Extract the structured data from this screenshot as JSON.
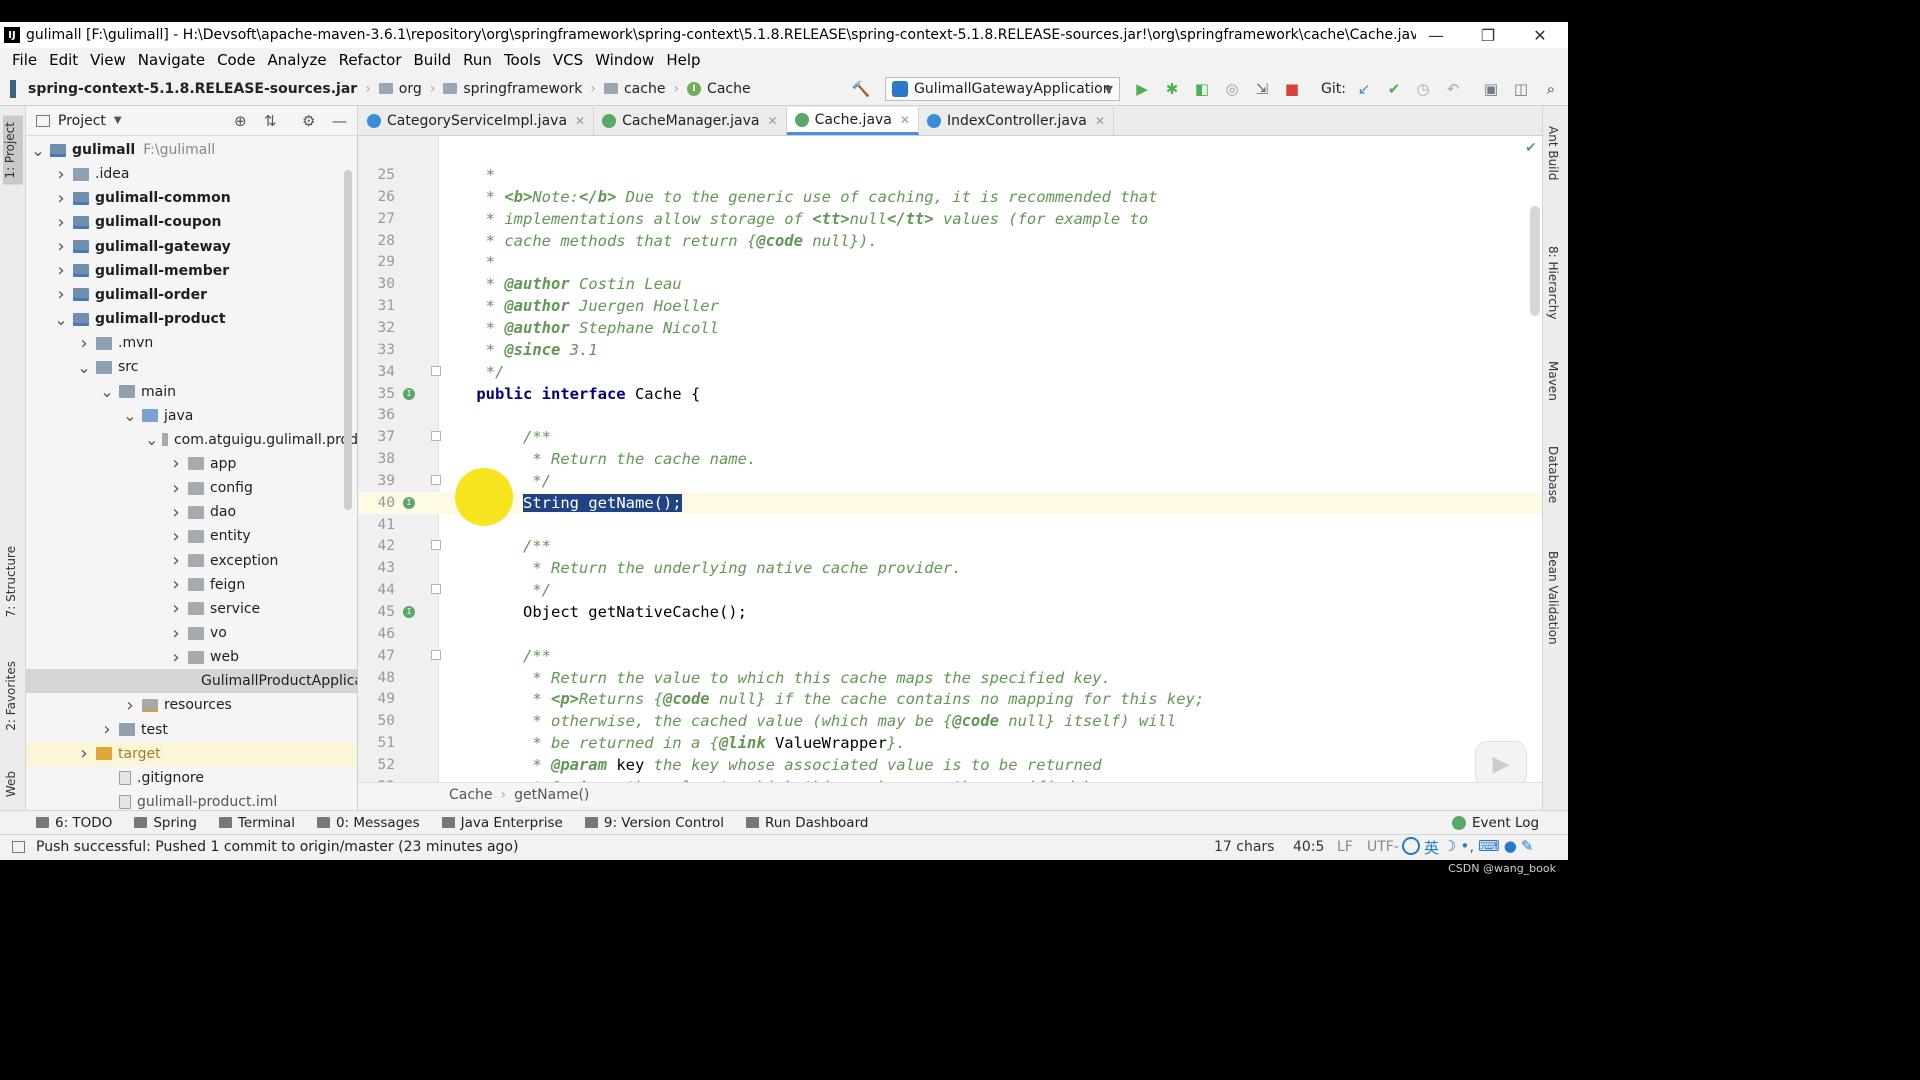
{
  "window": {
    "title": "gulimall [F:\\gulimall] - H:\\Devsoft\\apache-maven-3.6.1\\repository\\org\\springframework\\spring-context\\5.1.8.RELEASE\\spring-context-5.1.8.RELEASE-sources.jar!\\org\\springframework\\cache\\Cache.java [Ma...",
    "controls": {
      "minimize": "—",
      "restore": "❐",
      "close": "✕"
    }
  },
  "menu": [
    "File",
    "Edit",
    "View",
    "Navigate",
    "Code",
    "Analyze",
    "Refactor",
    "Build",
    "Run",
    "Tools",
    "VCS",
    "Window",
    "Help"
  ],
  "breadcrumb": [
    "spring-context-5.1.8.RELEASE-sources.jar",
    "org",
    "springframework",
    "cache",
    "Cache"
  ],
  "toolbar": {
    "run_config": "GulimallGatewayApplication",
    "git_label": "Git:"
  },
  "left_tool_tabs": {
    "project": "1: Project",
    "structure": "7: Structure",
    "favorites": "2: Favorites",
    "web": "Web"
  },
  "project_panel": {
    "title": "Project",
    "tree": [
      {
        "label": "gulimall",
        "hint": "F:\\gulimall",
        "depth": 0,
        "arrow": "down",
        "icon": "module",
        "bold": true
      },
      {
        "label": ".idea",
        "depth": 1,
        "arrow": "right",
        "icon": "folder"
      },
      {
        "label": "gulimall-common",
        "depth": 1,
        "arrow": "right",
        "icon": "module",
        "bold": true
      },
      {
        "label": "gulimall-coupon",
        "depth": 1,
        "arrow": "right",
        "icon": "module",
        "bold": true
      },
      {
        "label": "gulimall-gateway",
        "depth": 1,
        "arrow": "right",
        "icon": "module",
        "bold": true
      },
      {
        "label": "gulimall-member",
        "depth": 1,
        "arrow": "right",
        "icon": "module",
        "bold": true
      },
      {
        "label": "gulimall-order",
        "depth": 1,
        "arrow": "right",
        "icon": "module",
        "bold": true
      },
      {
        "label": "gulimall-product",
        "depth": 1,
        "arrow": "down",
        "icon": "module",
        "bold": true
      },
      {
        "label": ".mvn",
        "depth": 2,
        "arrow": "right",
        "icon": "folder"
      },
      {
        "label": "src",
        "depth": 2,
        "arrow": "down",
        "icon": "folder"
      },
      {
        "label": "main",
        "depth": 3,
        "arrow": "down",
        "icon": "folder"
      },
      {
        "label": "java",
        "depth": 4,
        "arrow": "down",
        "icon": "src"
      },
      {
        "label": "com.atguigu.gulimall.prod",
        "depth": 5,
        "arrow": "down",
        "icon": "pkg"
      },
      {
        "label": "app",
        "depth": 6,
        "arrow": "right",
        "icon": "pkg"
      },
      {
        "label": "config",
        "depth": 6,
        "arrow": "right",
        "icon": "pkg"
      },
      {
        "label": "dao",
        "depth": 6,
        "arrow": "right",
        "icon": "pkg"
      },
      {
        "label": "entity",
        "depth": 6,
        "arrow": "right",
        "icon": "pkg"
      },
      {
        "label": "exception",
        "depth": 6,
        "arrow": "right",
        "icon": "pkg"
      },
      {
        "label": "feign",
        "depth": 6,
        "arrow": "right",
        "icon": "pkg"
      },
      {
        "label": "service",
        "depth": 6,
        "arrow": "right",
        "icon": "pkg"
      },
      {
        "label": "vo",
        "depth": 6,
        "arrow": "right",
        "icon": "pkg"
      },
      {
        "label": "web",
        "depth": 6,
        "arrow": "right",
        "icon": "pkg"
      },
      {
        "label": "GulimallProductApplica",
        "depth": 7,
        "arrow": "none",
        "icon": "class",
        "selected": true
      },
      {
        "label": "resources",
        "depth": 4,
        "arrow": "right",
        "icon": "res"
      },
      {
        "label": "test",
        "depth": 3,
        "arrow": "right",
        "icon": "folder"
      },
      {
        "label": "target",
        "depth": 2,
        "arrow": "right",
        "icon": "target",
        "highlight": true
      },
      {
        "label": ".gitignore",
        "depth": 3,
        "arrow": "none",
        "icon": "file"
      },
      {
        "label": "gulimall-product.iml",
        "depth": 3,
        "arrow": "none",
        "icon": "file"
      }
    ]
  },
  "tabs": [
    {
      "label": "CategoryServiceImpl.java",
      "icon_color": "#3c8bd9",
      "active": false
    },
    {
      "label": "CacheManager.java",
      "icon_color": "#59a869",
      "active": false
    },
    {
      "label": "Cache.java",
      "icon_color": "#59a869",
      "active": true
    },
    {
      "label": "IndexController.java",
      "icon_color": "#3c8bd9",
      "active": false
    }
  ],
  "editor": {
    "current_line": 40,
    "lines": [
      {
        "n": 25,
        "segs": [
          [
            "cm",
            "     *"
          ]
        ]
      },
      {
        "n": 26,
        "segs": [
          [
            "cm",
            "     * "
          ],
          [
            "tag",
            "<b>"
          ],
          [
            "cm",
            "Note:"
          ],
          [
            "tag",
            "</b>"
          ],
          [
            "cm",
            " Due to the generic use of caching, it is recommended that"
          ]
        ]
      },
      {
        "n": 27,
        "segs": [
          [
            "cm",
            "     * implementations allow storage of "
          ],
          [
            "tag",
            "<tt>"
          ],
          [
            "cm",
            "null"
          ],
          [
            "tag",
            "</tt>"
          ],
          [
            "cm",
            " values (for example to"
          ]
        ]
      },
      {
        "n": 28,
        "segs": [
          [
            "cm",
            "     * cache methods that return {"
          ],
          [
            "tag",
            "@code"
          ],
          [
            "cm",
            " null})."
          ]
        ]
      },
      {
        "n": 29,
        "segs": [
          [
            "cm",
            "     *"
          ]
        ]
      },
      {
        "n": 30,
        "segs": [
          [
            "cm",
            "     * "
          ],
          [
            "tag",
            "@author"
          ],
          [
            "cm",
            " Costin Leau"
          ]
        ]
      },
      {
        "n": 31,
        "segs": [
          [
            "cm",
            "     * "
          ],
          [
            "tag",
            "@author"
          ],
          [
            "cm",
            " Juergen Hoeller"
          ]
        ]
      },
      {
        "n": 32,
        "segs": [
          [
            "cm",
            "     * "
          ],
          [
            "tag",
            "@author"
          ],
          [
            "cm",
            " Stephane Nicoll"
          ]
        ]
      },
      {
        "n": 33,
        "segs": [
          [
            "cm",
            "     * "
          ],
          [
            "tag",
            "@since"
          ],
          [
            "cm",
            " 3.1"
          ]
        ]
      },
      {
        "n": 34,
        "fold": true,
        "segs": [
          [
            "cm",
            "     */"
          ]
        ]
      },
      {
        "n": 35,
        "impl": true,
        "segs": [
          [
            "kw",
            "    public interface"
          ],
          [
            "code",
            " Cache {"
          ]
        ]
      },
      {
        "n": 36,
        "segs": []
      },
      {
        "n": 37,
        "fold": true,
        "segs": [
          [
            "cm",
            "         /**"
          ]
        ]
      },
      {
        "n": 38,
        "segs": [
          [
            "cm",
            "          * Return the cache name."
          ]
        ]
      },
      {
        "n": 39,
        "fold": true,
        "segs": [
          [
            "cm",
            "          */"
          ]
        ]
      },
      {
        "n": 40,
        "impl": true,
        "segs": [
          [
            "code",
            "         "
          ],
          [
            "sel",
            "String getName();"
          ]
        ]
      },
      {
        "n": 41,
        "segs": []
      },
      {
        "n": 42,
        "fold": true,
        "segs": [
          [
            "cm",
            "         /**"
          ]
        ]
      },
      {
        "n": 43,
        "segs": [
          [
            "cm",
            "          * Return the underlying native cache provider."
          ]
        ]
      },
      {
        "n": 44,
        "fold": true,
        "segs": [
          [
            "cm",
            "          */"
          ]
        ]
      },
      {
        "n": 45,
        "impl": true,
        "segs": [
          [
            "code",
            "         Object getNativeCache();"
          ]
        ]
      },
      {
        "n": 46,
        "segs": []
      },
      {
        "n": 47,
        "fold": true,
        "segs": [
          [
            "cm",
            "         /**"
          ]
        ]
      },
      {
        "n": 48,
        "segs": [
          [
            "cm",
            "          * Return the value to which this cache maps the specified key."
          ]
        ]
      },
      {
        "n": 49,
        "segs": [
          [
            "cm",
            "          * "
          ],
          [
            "tag",
            "<p>"
          ],
          [
            "cm",
            "Returns {"
          ],
          [
            "tag",
            "@code"
          ],
          [
            "cm",
            " null} if the cache contains no mapping for this key;"
          ]
        ]
      },
      {
        "n": 50,
        "segs": [
          [
            "cm",
            "          * otherwise, the cached value (which may be {"
          ],
          [
            "tag",
            "@code"
          ],
          [
            "cm",
            " null} itself) will"
          ]
        ]
      },
      {
        "n": 51,
        "segs": [
          [
            "cm",
            "          * be returned in a {"
          ],
          [
            "tag",
            "@link"
          ],
          [
            "code",
            " ValueWrapper"
          ],
          [
            "cm",
            "}."
          ]
        ]
      },
      {
        "n": 52,
        "segs": [
          [
            "cm",
            "          * "
          ],
          [
            "tag",
            "@param"
          ],
          [
            "code",
            " key"
          ],
          [
            "cm",
            " the key whose associated value is to be returned"
          ]
        ]
      },
      {
        "n": 53,
        "segs": [
          [
            "cm",
            "          * "
          ],
          [
            "tag",
            "@return"
          ],
          [
            "cm",
            " the value to which this cache maps the specified key,"
          ]
        ]
      }
    ],
    "breadcrumb": [
      "Cache",
      "getName()"
    ]
  },
  "right_tool_tabs": [
    "Ant Build",
    "8: Hierarchy",
    "Maven",
    "Database",
    "Bean Validation"
  ],
  "tool_windows": [
    "6: TODO",
    "Spring",
    "Terminal",
    "0: Messages",
    "Java Enterprise",
    "9: Version Control",
    "Run Dashboard"
  ],
  "event_log": "Event Log",
  "status": {
    "message": "Push successful: Pushed 1 commit to origin/master (23 minutes ago)",
    "chars": "17 chars",
    "position": "40:5",
    "line_sep": "LF",
    "encoding": "UTF-",
    "ime": "英"
  },
  "watermark": "CSDN @wang_book"
}
